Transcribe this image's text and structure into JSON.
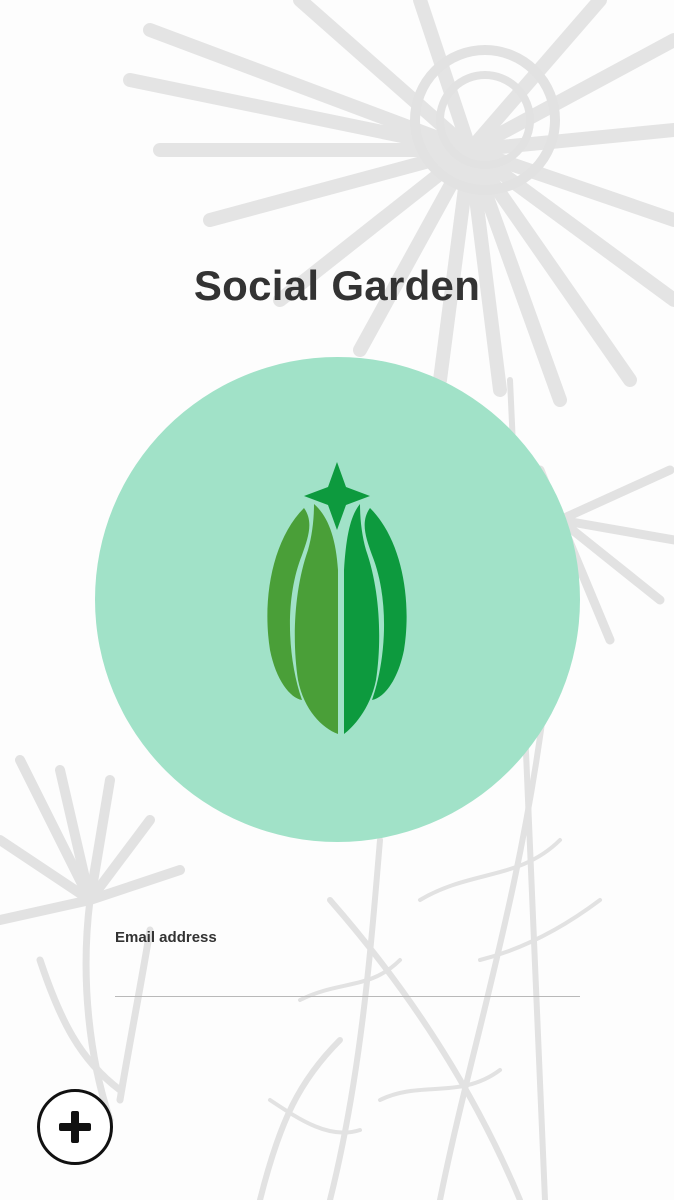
{
  "app": {
    "title": "Social Garden"
  },
  "login_form": {
    "email_label": "Email address",
    "email_value": "",
    "email_placeholder": ""
  },
  "fab": {
    "icon": "plus-icon"
  },
  "colors": {
    "logo_circle": "#a1e2c8",
    "leaf_light_green": "#4a9f38",
    "leaf_dark_green": "#0d9a3e",
    "title_text": "#333333",
    "background_art": "#e4e4e4"
  }
}
